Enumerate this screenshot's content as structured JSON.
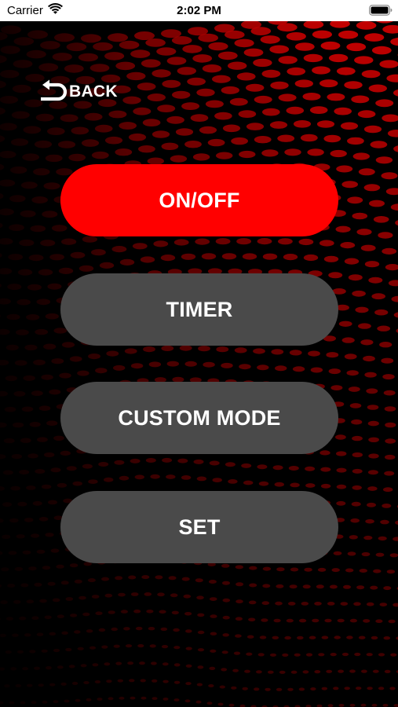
{
  "status_bar": {
    "carrier": "Carrier",
    "time": "2:02 PM",
    "wifi_icon": "wifi-icon",
    "battery_icon": "battery-icon"
  },
  "nav": {
    "back_label": "BACK",
    "back_icon": "return-arrow-icon"
  },
  "buttons": [
    {
      "label": "ON/OFF",
      "active": true
    },
    {
      "label": "TIMER",
      "active": false
    },
    {
      "label": "CUSTOM MODE",
      "active": false
    },
    {
      "label": "SET",
      "active": false
    }
  ],
  "colors": {
    "accent": "#ff0000",
    "button_gray": "#4a4a4a",
    "background": "#000000",
    "pattern": "#c40000",
    "text": "#ffffff"
  }
}
